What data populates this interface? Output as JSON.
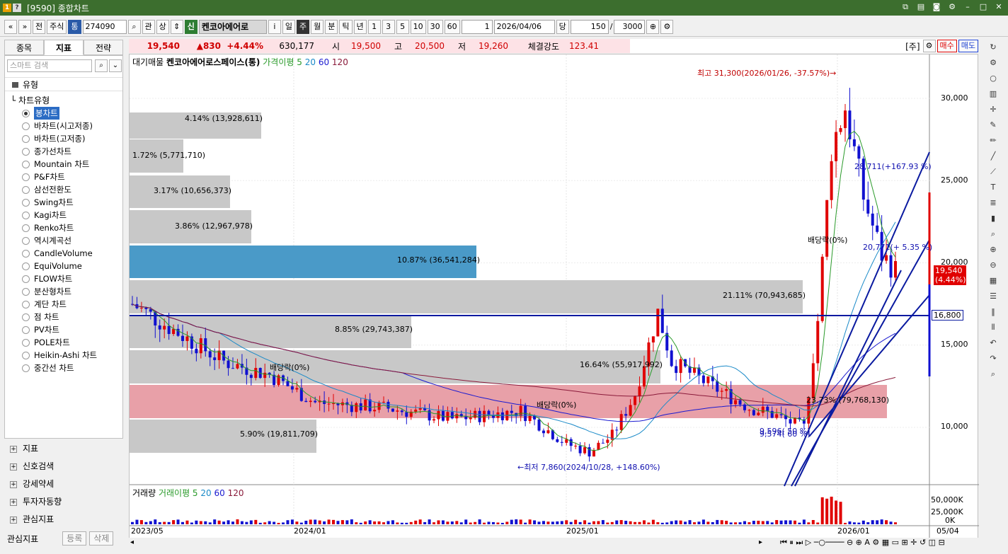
{
  "window": {
    "title": "[9590] 종합차트"
  },
  "toolbar": {
    "nav_prev": "«",
    "nav_next": "»",
    "jeon": "전",
    "market": "주식",
    "tong": "통",
    "code": "274090",
    "gwan": "관",
    "sang": "상",
    "sin": "신",
    "name": "켄코아에어로",
    "info": "i",
    "periods": [
      "일",
      "주",
      "월",
      "분",
      "틱",
      "년"
    ],
    "period_selected": "주",
    "minutes": [
      "1",
      "3",
      "5",
      "10",
      "30",
      "60"
    ],
    "multiplier": "1",
    "date": "2026/04/06",
    "dang": "당",
    "count": "150",
    "slash": "/",
    "total": "3000"
  },
  "left_tabs": [
    "종목",
    "지표",
    "전략"
  ],
  "left_tab_selected": "지표",
  "search_placeholder": "스마트 검색",
  "section_type": "유형",
  "tree_root": "차트유형",
  "chart_types": [
    "봉차트",
    "바차트(시고저종)",
    "바차트(고저종)",
    "종가선차트",
    "Mountain 차트",
    "P&F차트",
    "삼선전환도",
    "Swing차트",
    "Kagi차트",
    "Renko차트",
    "역시계곡선",
    "CandleVolume",
    "EquiVolume",
    "FLOW차트",
    "분산형차트",
    "계단 차트",
    "점 차트",
    "PV차트",
    "POLE차트",
    "Heikin-Ashi 차트",
    "중간선 차트"
  ],
  "chart_type_selected": "봉차트",
  "left_sections": [
    "지표",
    "신호검색",
    "강세약세",
    "투자자동향",
    "관심지표"
  ],
  "fav": {
    "label": "관심지표",
    "add": "등록",
    "del": "삭제"
  },
  "price": {
    "current": "19,540",
    "change": "▲830",
    "pct": "+4.44%",
    "volume": "630,177",
    "open_lbl": "시",
    "open": "19,500",
    "high_lbl": "고",
    "high": "20,500",
    "low_lbl": "저",
    "low": "19,260",
    "strength_lbl": "체결강도",
    "strength": "123.41",
    "jusik": "[주]",
    "buy": "매수",
    "sell": "매도"
  },
  "legend": {
    "p1": "대기매물",
    "p2": "켄코아에어로스페이스(통)",
    "p3": "가격이평 5",
    "p4": "20",
    "p5": "60",
    "p6": "120"
  },
  "vol_legend": {
    "v1": "거래량",
    "v2": "거래이평 5",
    "v3": "20",
    "v4": "60",
    "v5": "120"
  },
  "annotations": {
    "high": "최고 31,300(2026/01/26, -37.57%)→",
    "low": "←최저 7,860(2024/10/28, +148.60%)",
    "div1": "배당락(0%)",
    "div2": "배당락(0%)",
    "div3": "배당락(0%)",
    "fib1": "28,711(+167.93 %)",
    "fib2": "20,771(+ 5.35 %)",
    "fib3": "9,596( 50 %)",
    "fib4": "9,574( 60 %)",
    "cur_tag": "19,540",
    "cur_pct": "(4.44%)",
    "hline": "16,800"
  },
  "vp_labels": [
    "4.14% (13,928,611)",
    "1.72% (5,771,710)",
    "3.17% (10,656,373)",
    "3.86% (12,967,978)",
    "10.87% (36,541,284)",
    "21.11% (70,943,685)",
    "8.85% (29,743,387)",
    "16.64% (55,917,992)",
    "23.73% (79,768,130)",
    "5.90% (19,811,709)"
  ],
  "y_axis": [
    "30,000",
    "25,000",
    "20,000",
    "15,000",
    "10,000"
  ],
  "vol_axis": [
    "50,000K",
    "25,000K",
    "0K"
  ],
  "x_axis": [
    "2023/05",
    "2024/01",
    "2025/01",
    "2026/01",
    "05/04"
  ],
  "colors": {
    "up": "#e00000",
    "down": "#1010d0",
    "vp_gray": "#c8c8c8",
    "vp_blue": "#4a9ac8",
    "vp_pink": "#e8a0a8",
    "line": "#0a1aa0"
  }
}
